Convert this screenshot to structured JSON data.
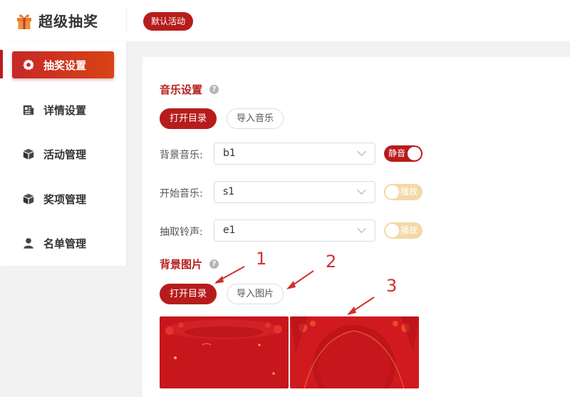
{
  "header": {
    "app_title": "超级抽奖",
    "logo_icon": "gift-icon",
    "activity_tag": "默认活动"
  },
  "sidebar": {
    "items": [
      {
        "label": "抽奖设置",
        "icon": "gear-icon",
        "active": true
      },
      {
        "label": "详情设置",
        "icon": "document-icon",
        "active": false
      },
      {
        "label": "活动管理",
        "icon": "box-icon",
        "active": false
      },
      {
        "label": "奖项管理",
        "icon": "box-icon",
        "active": false
      },
      {
        "label": "名单管理",
        "icon": "user-icon",
        "active": false
      }
    ]
  },
  "music": {
    "title": "音乐设置",
    "open_dir": "打开目录",
    "import": "导入音乐",
    "rows": [
      {
        "label": "背景音乐:",
        "value": "b1",
        "toggle": "静音",
        "toggle_on": true
      },
      {
        "label": "开始音乐:",
        "value": "s1",
        "toggle": "播放",
        "toggle_on": false
      },
      {
        "label": "抽取铃声:",
        "value": "e1",
        "toggle": "播放",
        "toggle_on": false
      }
    ]
  },
  "background": {
    "title": "背景图片",
    "open_dir": "打开目录",
    "import": "导入图片"
  },
  "annotations": [
    "1",
    "2",
    "3"
  ],
  "colors": {
    "accent": "#b71c1c",
    "toggle_off": "#f3d9a6"
  }
}
